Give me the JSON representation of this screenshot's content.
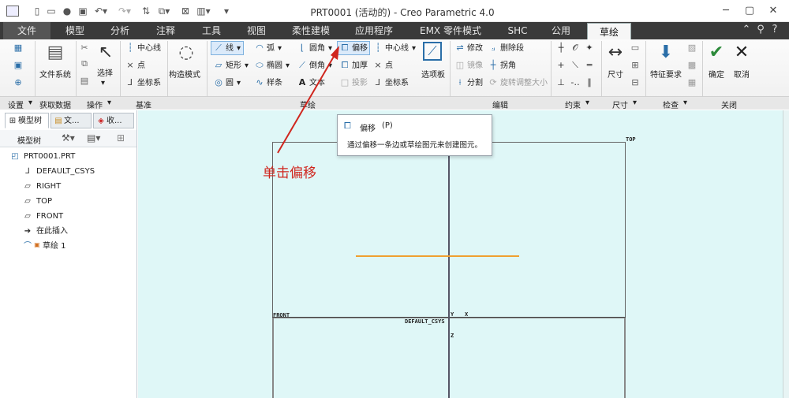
{
  "window": {
    "title": "PRT0001 (活动的) - Creo Parametric 4.0"
  },
  "tabs": [
    "文件",
    "模型",
    "分析",
    "注释",
    "工具",
    "视图",
    "柔性建模",
    "应用程序",
    "EMX 零件模式",
    "SHC",
    "公用",
    "草绘"
  ],
  "active_tab": "草绘",
  "ribbon": {
    "groups": {
      "setup": "设置",
      "get_data": "获取数据",
      "operations": "操作",
      "datum": "基准",
      "sketching": "草绘",
      "editing": "编辑",
      "constrain": "约束",
      "dimension": "尺寸",
      "inspect": "检查",
      "close": "关闭"
    },
    "buttons": {
      "file_system": "文件系统",
      "select": "选择",
      "centerline": "中心线",
      "point": "点",
      "coordinate_system": "坐标系",
      "construction_mode": "构造模式",
      "line": "线",
      "rectangle": "矩形",
      "circle": "圆",
      "arc": "弧",
      "ellipse": "椭圆",
      "spline": "样条",
      "fillet": "圆角",
      "chamfer": "倒角",
      "text": "文本",
      "offset": "偏移",
      "thicken": "加厚",
      "project": "投影",
      "sk_centerline": "中心线",
      "sk_point": "点",
      "sk_coordinate_system": "坐标系",
      "palette": "选项板",
      "modify": "修改",
      "delete_segment": "删除段",
      "mirror": "镜像",
      "corner": "拐角",
      "divide": "分割",
      "rotate_resize": "旋转调整大小",
      "dimension": "尺寸",
      "feature_requirements": "特征要求",
      "ok": "确定",
      "cancel": "取消"
    }
  },
  "model_tree": {
    "tabs": [
      "模型树",
      "文...",
      "收..."
    ],
    "header": "模型树",
    "items": [
      "PRT0001.PRT",
      "DEFAULT_CSYS",
      "RIGHT",
      "TOP",
      "FRONT",
      "在此插入",
      "草绘 1"
    ]
  },
  "canvas": {
    "labels": {
      "top": "TOP",
      "front": "FRONT",
      "csys": "DEFAULT_CSYS",
      "axis_y": "Y",
      "axis_x": "X",
      "axis_z": "Z"
    }
  },
  "tooltip": {
    "title": "偏移",
    "shortcut": "(P)",
    "description": "通过偏移一条边或草绘图元来创建图元。"
  },
  "annotation": {
    "text": "单击偏移",
    "color": "#d0261e"
  },
  "colors": {
    "tab_bar": "#3a3a3a",
    "canvas_bg": "#dff7f7",
    "sketch_line": "#f0a030"
  }
}
